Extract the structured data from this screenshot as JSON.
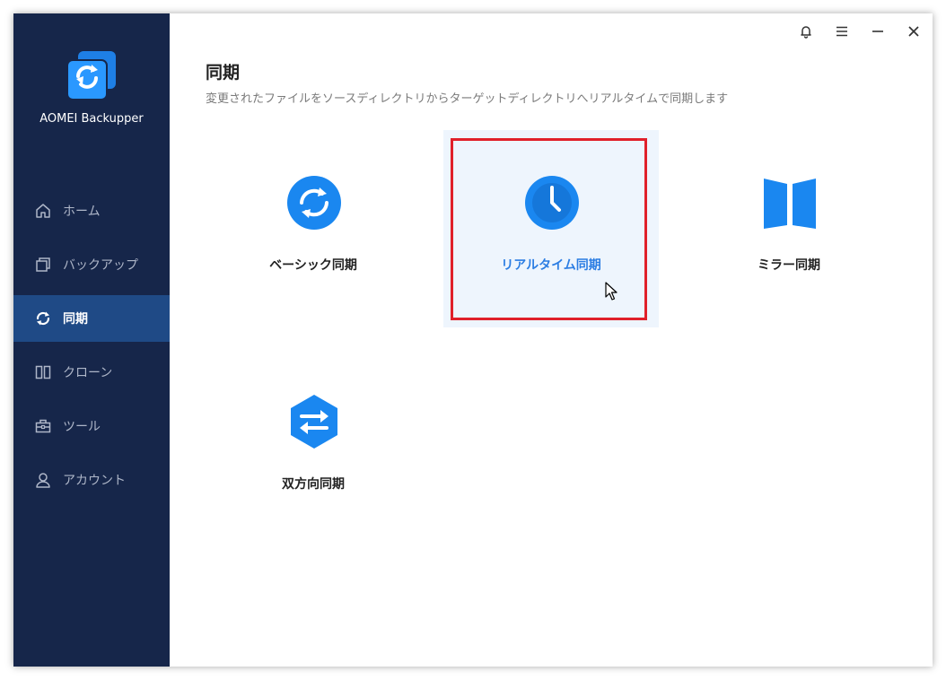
{
  "app": {
    "name": "AOMEI Backupper"
  },
  "sidebar": {
    "items": [
      {
        "label": "ホーム",
        "icon": "home-icon"
      },
      {
        "label": "バックアップ",
        "icon": "backup-icon"
      },
      {
        "label": "同期",
        "icon": "sync-icon",
        "active": true
      },
      {
        "label": "クローン",
        "icon": "clone-icon"
      },
      {
        "label": "ツール",
        "icon": "tools-icon"
      },
      {
        "label": "アカウント",
        "icon": "account-icon"
      }
    ]
  },
  "titlebar": {
    "buttons": [
      "bell-icon",
      "menu-icon",
      "minimize-icon",
      "close-icon"
    ]
  },
  "main": {
    "title": "同期",
    "subtitle": "変更されたファイルをソースディレクトリからターゲットディレクトリへリアルタイムで同期します",
    "options": [
      {
        "label": "ベーシック同期",
        "icon": "basic-sync-icon"
      },
      {
        "label": "リアルタイム同期",
        "icon": "realtime-sync-icon",
        "selected": true
      },
      {
        "label": "ミラー同期",
        "icon": "mirror-sync-icon"
      },
      {
        "label": "双方向同期",
        "icon": "two-way-sync-icon"
      }
    ]
  },
  "colors": {
    "sidebar_bg": "#16264a",
    "sidebar_active": "#1f4a86",
    "accent": "#2b7de3",
    "icon_blue": "#1a87f0",
    "highlight": "#e0202a"
  }
}
